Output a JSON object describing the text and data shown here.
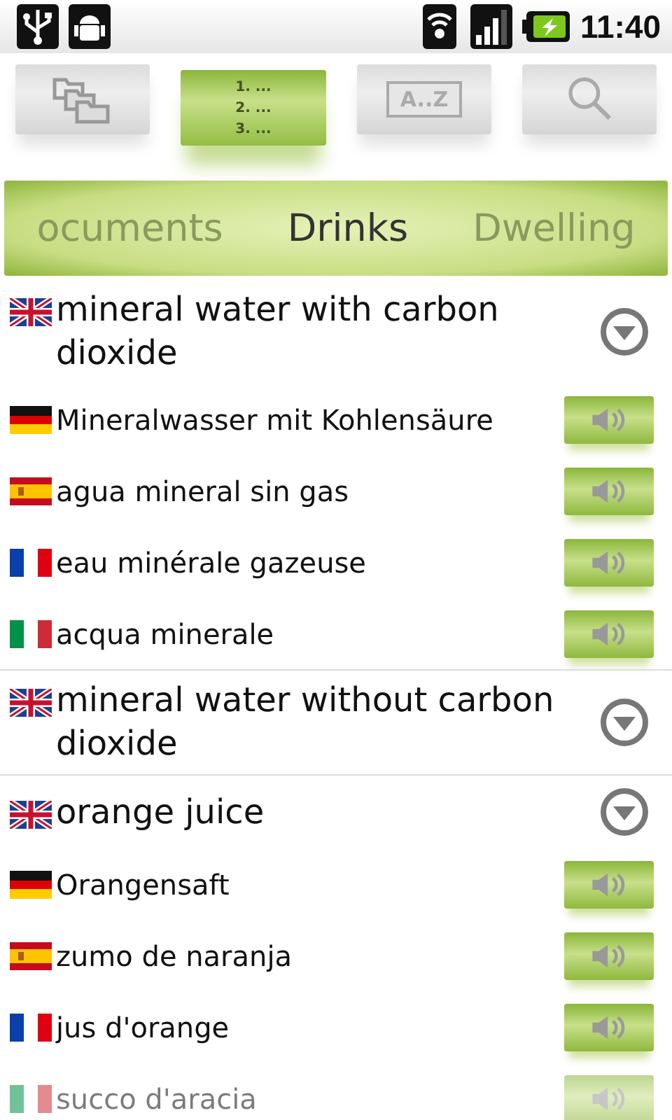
{
  "status_bar": {
    "time": "11:40"
  },
  "toolbar": [
    {
      "kind": "folders",
      "selected": false
    },
    {
      "kind": "list",
      "selected": true,
      "lines": [
        "1. ...",
        "2. ...",
        "3. ..."
      ]
    },
    {
      "kind": "az",
      "selected": false,
      "label": "A..Z"
    },
    {
      "kind": "search",
      "selected": false
    }
  ],
  "categories": [
    {
      "label": "ocuments",
      "selected": false
    },
    {
      "label": "Drinks",
      "selected": true
    },
    {
      "label": "Dwelling",
      "selected": false
    }
  ],
  "entries": [
    {
      "kind": "uk",
      "term": "mineral water with carbon dioxide",
      "translations": [
        {
          "kind": "germany",
          "text": "Mineralwasser mit Kohlensäure"
        },
        {
          "kind": "spain",
          "text": "agua mineral sin gas"
        },
        {
          "kind": "france",
          "text": "eau minérale gazeuse"
        },
        {
          "kind": "italy",
          "text": "acqua minerale"
        }
      ]
    },
    {
      "kind": "uk",
      "term": "mineral water without carbon dioxide"
    },
    {
      "kind": "uk",
      "term": "orange juice",
      "translations": [
        {
          "kind": "germany",
          "text": "Orangensaft"
        },
        {
          "kind": "spain",
          "text": "zumo de naranja"
        },
        {
          "kind": "france",
          "text": "jus d'orange"
        },
        {
          "kind": "italy",
          "text": "succo d'aracia"
        }
      ]
    }
  ]
}
